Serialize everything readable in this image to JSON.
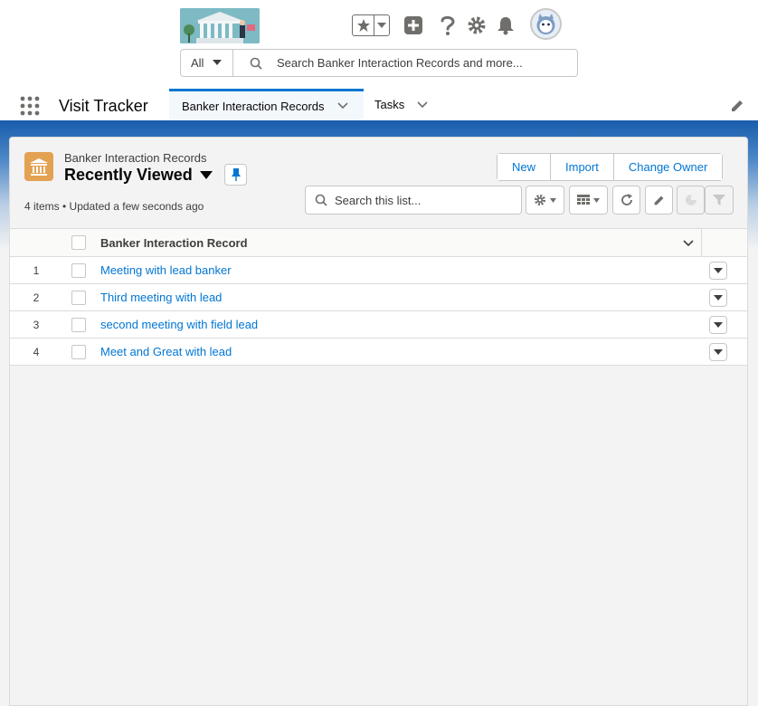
{
  "global_header": {
    "search_scope": "All",
    "search_placeholder": "Search Banker Interaction Records and more..."
  },
  "nav": {
    "app_name": "Visit Tracker",
    "tabs": [
      {
        "label": "Banker Interaction Records",
        "active": true
      },
      {
        "label": "Tasks",
        "active": false
      }
    ]
  },
  "list_view": {
    "object_name": "Banker Interaction Records",
    "view_name": "Recently Viewed",
    "meta": "4 items • Updated a few seconds ago",
    "actions": {
      "new": "New",
      "import": "Import",
      "change_owner": "Change Owner"
    },
    "search_placeholder": "Search this list...",
    "column_header": "Banker Interaction Record",
    "rows": [
      {
        "num": "1",
        "name": "Meeting with lead banker"
      },
      {
        "num": "2",
        "name": "Third meeting with lead"
      },
      {
        "num": "3",
        "name": "second meeting with field lead"
      },
      {
        "num": "4",
        "name": "Meet and Great with lead"
      }
    ]
  },
  "icons": {
    "favorites": "star-icon",
    "new": "plus-icon",
    "help": "question-icon",
    "setup": "gear-icon",
    "notifications": "bell-icon",
    "object": "bank-icon"
  },
  "colors": {
    "brand_blue": "#0176d3",
    "nav_underline": "#1b5fae",
    "object_icon": "#e3a152"
  }
}
